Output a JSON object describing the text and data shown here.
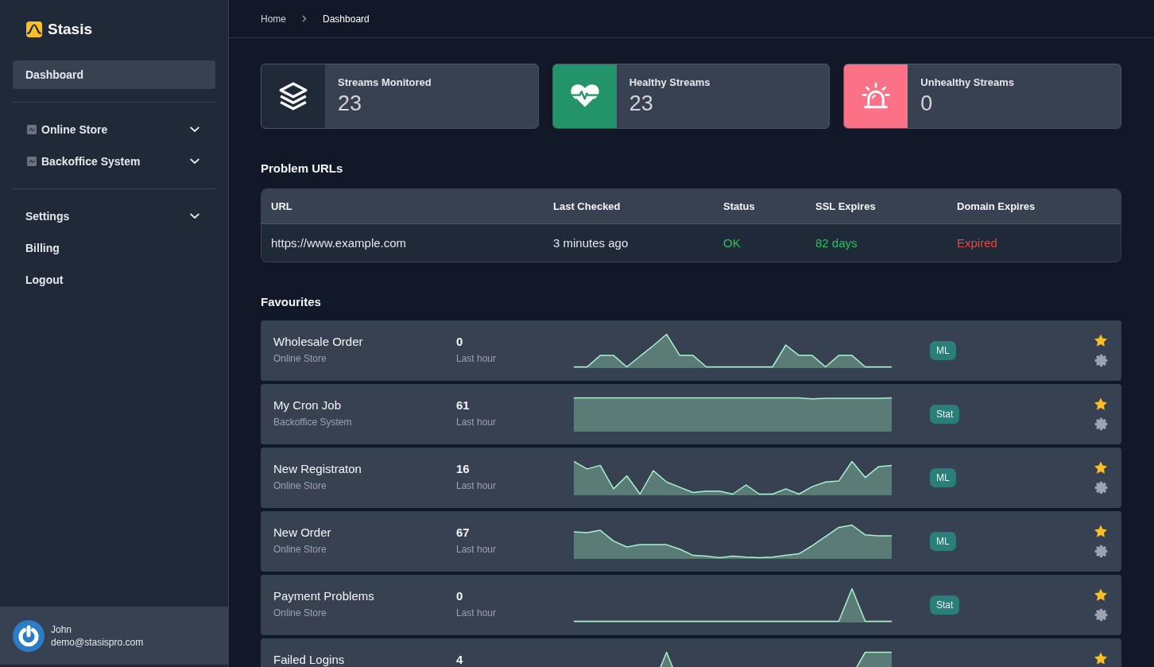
{
  "sidebar": {
    "brand": "Stasis",
    "sections": [
      {
        "items": [
          {
            "label": "Dashboard",
            "kind": "link",
            "selected": true
          }
        ]
      },
      {
        "items": [
          {
            "label": "Online Store",
            "kind": "stream_group",
            "selected": false,
            "expanded": false
          },
          {
            "label": "Backoffice System",
            "kind": "stream_group",
            "selected": false,
            "expanded": false
          }
        ]
      },
      {
        "items": [
          {
            "label": "Settings",
            "kind": "menu",
            "selected": false,
            "expanded": false
          },
          {
            "label": "Billing",
            "kind": "link",
            "selected": false
          },
          {
            "label": "Logout",
            "kind": "link",
            "selected": false
          }
        ]
      }
    ],
    "user": {
      "name": "John",
      "email": "demo@stasispro.com"
    }
  },
  "breadcrumb": [
    {
      "label": "Home",
      "current": false
    },
    {
      "label": "Dashboard",
      "current": true
    }
  ],
  "stats": [
    {
      "kind": "monitored",
      "label": "Streams Monitored",
      "value": "23",
      "color": "#1f2937"
    },
    {
      "kind": "healthy",
      "label": "Healthy Streams",
      "value": "23",
      "color": "#23936a"
    },
    {
      "kind": "unhealthy",
      "label": "Unhealthy Streams",
      "value": "0",
      "color": "#fb7185"
    }
  ],
  "problem_urls": {
    "title": "Problem URLs",
    "columns": [
      "URL",
      "Last Checked",
      "Status",
      "SSL Expires",
      "Domain Expires"
    ],
    "rows": [
      {
        "cells": [
          {
            "text": "https://www.example.com",
            "color": "#e5e7eb"
          },
          {
            "text": "3 minutes ago",
            "color": "#e5e7eb"
          },
          {
            "text": "OK",
            "color": "#22c55e"
          },
          {
            "text": "82 days",
            "color": "#22c55e"
          },
          {
            "text": "Expired",
            "color": "#ef4444"
          }
        ]
      }
    ]
  },
  "favourites": {
    "title": "Favourites",
    "rows": [
      {
        "name": "Wholesale Order",
        "group": "Online Store",
        "count": "0",
        "period": "Last hour",
        "badge": "ML",
        "favourite": true
      },
      {
        "name": "My Cron Job",
        "group": "Backoffice System",
        "count": "61",
        "period": "Last hour",
        "badge": "Stat",
        "favourite": true
      },
      {
        "name": "New Registraton",
        "group": "Online Store",
        "count": "16",
        "period": "Last hour",
        "badge": "ML",
        "favourite": true
      },
      {
        "name": "New Order",
        "group": "Online Store",
        "count": "67",
        "period": "Last hour",
        "badge": "ML",
        "favourite": true
      },
      {
        "name": "Payment Problems",
        "group": "Online Store",
        "count": "0",
        "period": "Last hour",
        "badge": "Stat",
        "favourite": true
      },
      {
        "name": "Failed Logins",
        "count": "4",
        "favourite": true
      }
    ]
  }
}
